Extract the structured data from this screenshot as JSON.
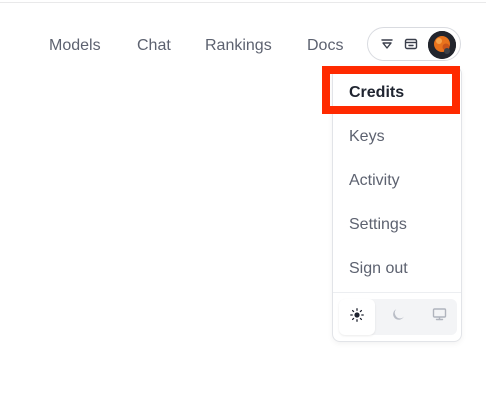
{
  "nav": {
    "links": [
      "Models",
      "Chat",
      "Rankings",
      "Docs"
    ]
  },
  "account_menu": {
    "items": [
      "Credits",
      "Keys",
      "Activity",
      "Settings",
      "Sign out"
    ],
    "active_item": "Credits",
    "theme_options": [
      "light",
      "dark",
      "system"
    ],
    "selected_theme": "light"
  },
  "icons": {
    "pill_left": "filter-triangle-icon",
    "pill_middle": "wallet-icon",
    "avatar": "user-avatar",
    "theme_light": "sun-icon",
    "theme_dark": "moon-icon",
    "theme_system": "monitor-icon"
  },
  "colors": {
    "highlight": "#ff2a00",
    "text_muted": "#5d6270",
    "text_active": "#1f2430"
  }
}
